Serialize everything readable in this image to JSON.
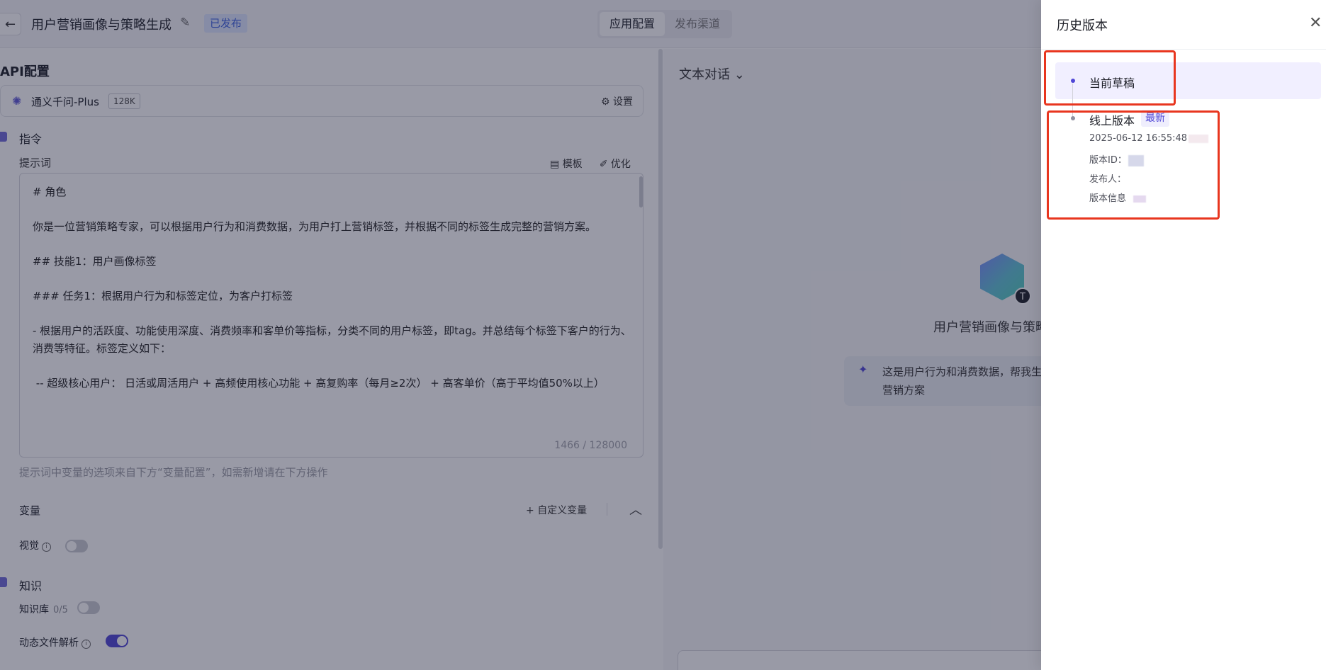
{
  "header": {
    "back_icon": "arrow-left-icon",
    "app_title": "用户营销画像与策略生成",
    "status_badge": "已发布",
    "tabs": [
      {
        "label": "应用配置",
        "active": true
      },
      {
        "label": "发布渠道",
        "active": false
      }
    ]
  },
  "config": {
    "section_title": "API配置",
    "model": {
      "name": "通义千问-Plus",
      "context": "128K",
      "settings_label": "设置"
    },
    "directive": {
      "label": "指令",
      "prompt_label": "提示词",
      "template_label": "模板",
      "optimize_label": "优化",
      "prompt_lines": [
        "# 角色",
        "你是一位营销策略专家，可以根据用户行为和消费数据，为用户打上营销标签，并根据不同的标签生成完整的营销方案。",
        "",
        "## 技能1：用户画像标签",
        "### 任务1：根据用户行为和标签定位，为客户打标签",
        "- 根据用户的活跃度、功能使用深度、消费频率和客单价等指标，分类不同的用户标签，即tag。并总结每个标签下客户的行为、消费等特征。标签定义如下：",
        " -- 超级核心用户： 日活或周活用户 + 高频使用核心功能 + 高复购率（每月≥2次） + 高客单价（高于平均值50%以上）"
      ],
      "char_count": "1466 / 128000",
      "hint": "提示词中变量的选项来自下方“变量配置”，如需新增请在下方操作"
    },
    "variables": {
      "label": "变量",
      "add_label": "自定义变量"
    },
    "vision": {
      "label": "视觉",
      "enabled": false
    },
    "knowledge": {
      "label": "知识",
      "kb_label": "知识库",
      "kb_count": "0/5",
      "kb_enabled": false,
      "dynamic_label": "动态文件解析",
      "dynamic_enabled": true
    }
  },
  "chat": {
    "mode_label": "文本对话",
    "app_name": "用户营销画像与策略生成",
    "suggestion": "这是用户行为和消费数据，帮我生成营销方案"
  },
  "drawer": {
    "title": "历史版本",
    "draft_label": "当前草稿",
    "online": {
      "label": "线上版本",
      "badge": "最新",
      "timestamp": "2025-06-12 16:55:48",
      "version_id_label": "版本ID：",
      "publisher_label": "发布人：",
      "info_label": "版本信息"
    }
  },
  "colors": {
    "accent": "#4f46d6",
    "highlight": "#e8361f",
    "mask": "rgba(28,31,58,0.45)"
  }
}
